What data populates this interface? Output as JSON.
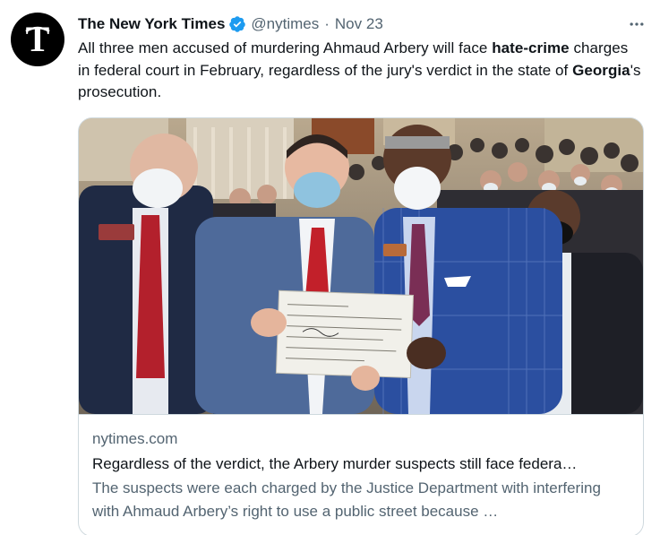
{
  "author": {
    "name": "The New York Times",
    "handle": "@nytimes",
    "separator": "·",
    "date": "Nov 23",
    "avatar_icon": "nyt-t-logo-icon",
    "verified_icon": "verified-badge-icon"
  },
  "tweet": {
    "text_1": "All three men accused of murdering Ahmaud Arbery will face ",
    "bold_1": "hate-crime",
    "text_2": " charges in federal court in February, regardless of the jury's verdict in the state of ",
    "bold_2": "Georgia",
    "text_3": "'s prosecution."
  },
  "card": {
    "domain": "nytimes.com",
    "title": "Regardless of the verdict, the Arbery murder suspects still face federa…",
    "description": "The suspects were each charged by the Justice Department with interfering with Ahmaud Arbery’s right to use a public street because …"
  },
  "colors": {
    "accent": "#1d9bf0",
    "text_primary": "#0f1419",
    "text_secondary": "#536471",
    "border": "#cfd9de"
  }
}
